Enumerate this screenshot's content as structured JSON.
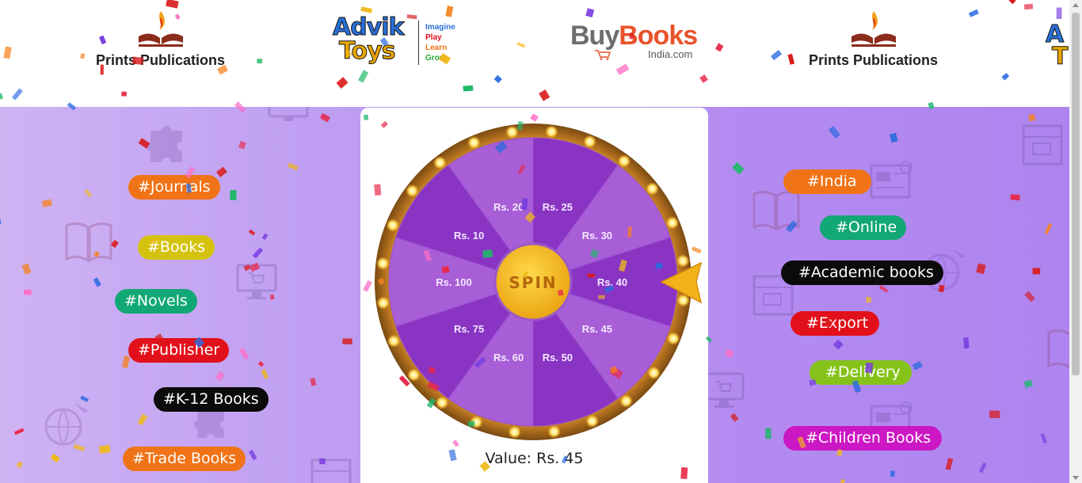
{
  "logos": {
    "prints_1": "Prints Publications",
    "advik": {
      "line1": "Advik",
      "line2": "Toys",
      "tags": [
        "Imagine",
        "Play",
        "Learn",
        "Grow"
      ]
    },
    "buybooks": {
      "buy": "Buy",
      "books": "Books",
      "sub": "India.com"
    },
    "prints_2": "Prints Publications"
  },
  "tags_left": [
    {
      "label": "#Journals",
      "color": "#f07317"
    },
    {
      "label": "#Books",
      "color": "#d4c20f"
    },
    {
      "label": "#Novels",
      "color": "#12a876"
    },
    {
      "label": "#Publisher",
      "color": "#e2101a"
    },
    {
      "label": "#K-12 Books",
      "color": "#0b0b0b"
    },
    {
      "label": "#Trade Books",
      "color": "#f07317"
    }
  ],
  "tags_right": [
    {
      "label": "#India",
      "color": "#f07317"
    },
    {
      "label": "#Online",
      "color": "#12a876"
    },
    {
      "label": "#Academic books",
      "color": "#0b0b0b"
    },
    {
      "label": "#Export",
      "color": "#e2101a"
    },
    {
      "label": "#Delivery",
      "color": "#86c31a"
    },
    {
      "label": "#Children Books",
      "color": "#cc17c4"
    }
  ],
  "wheel": {
    "segments": [
      "Rs. 25",
      "Rs. 30",
      "Rs. 40",
      "Rs. 45",
      "Rs. 50",
      "Rs. 60",
      "Rs. 75",
      "Rs. 100",
      "Rs. 10",
      "Rs. 20"
    ],
    "spin_label": "SPIN",
    "value_label": "Value: Rs. 45",
    "colors": {
      "dark": "#8a34c4",
      "light": "#a85ed6",
      "rim": "#c58a2e",
      "hub": "#f2b81f",
      "spin_text": "#b5650a"
    }
  },
  "background_icons": [
    "puzzle-icon",
    "book-icon",
    "monitor-cart-icon",
    "location-pin-icon",
    "newspaper-icon",
    "globe-plane-icon"
  ]
}
